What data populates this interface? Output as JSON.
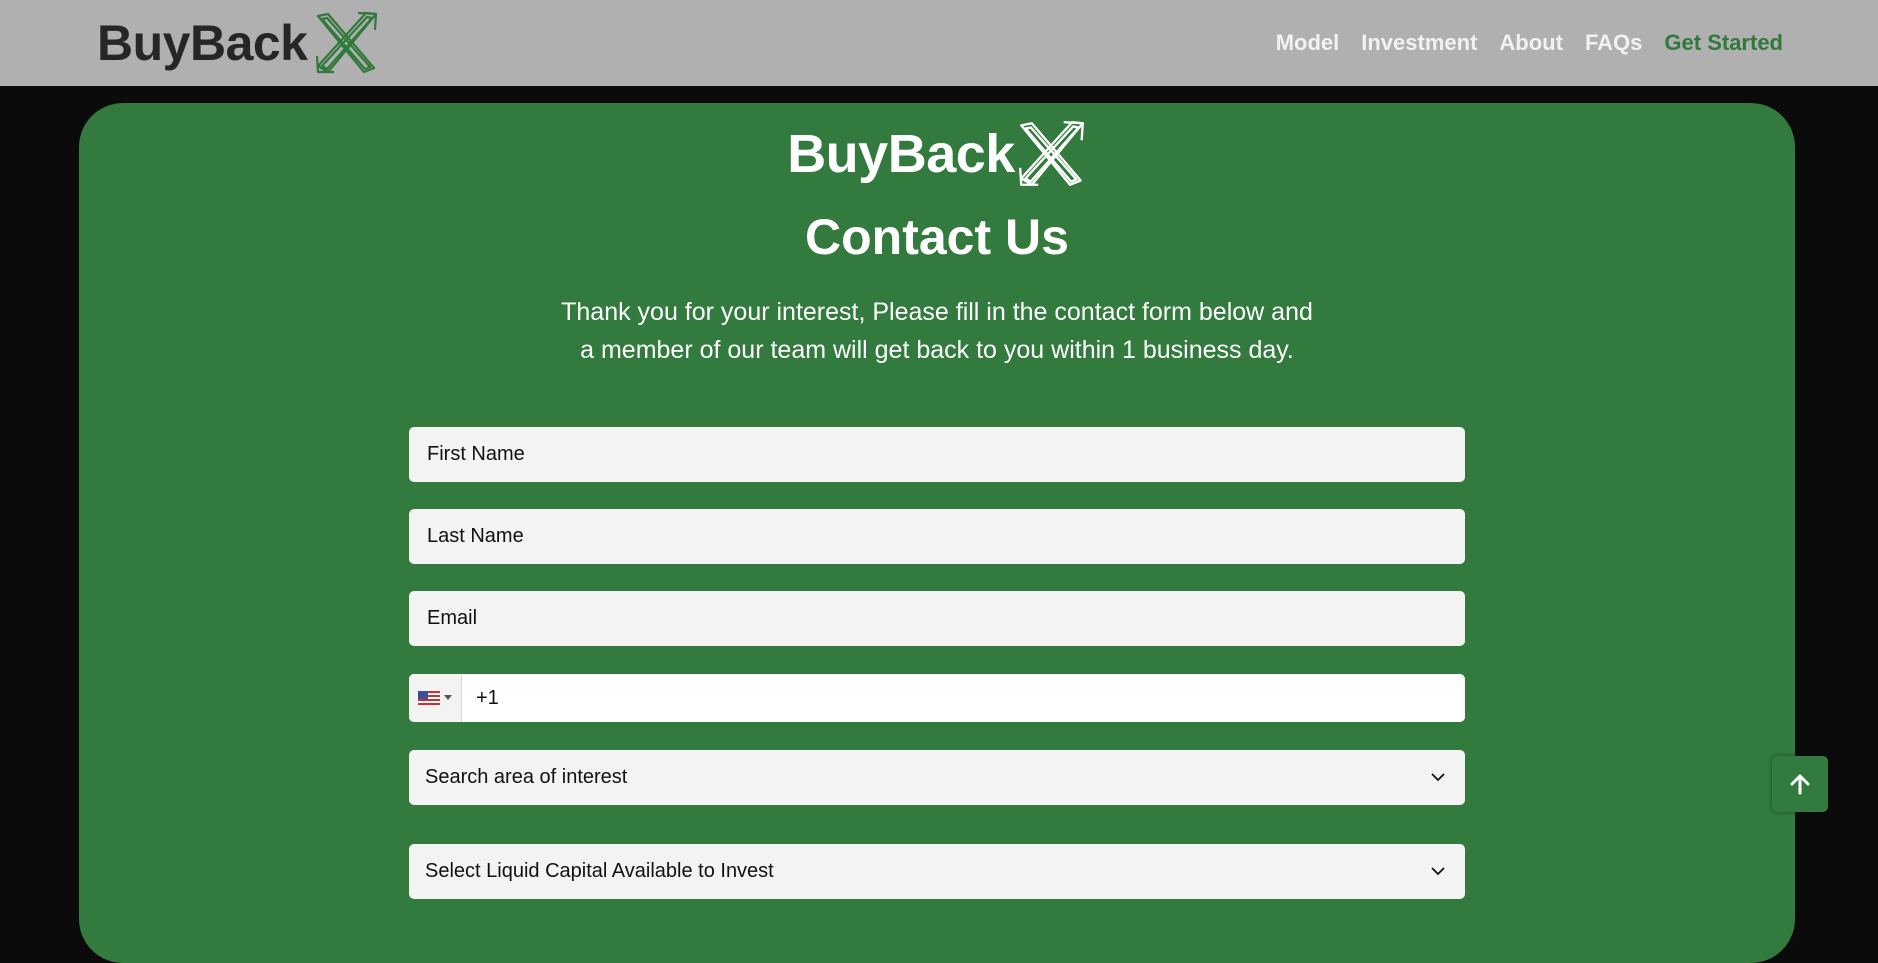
{
  "header": {
    "brand": "BuyBack",
    "nav": [
      {
        "label": "Model"
      },
      {
        "label": "Investment"
      },
      {
        "label": "About"
      },
      {
        "label": "FAQs"
      }
    ],
    "cta_label": "Get Started"
  },
  "card": {
    "brand": "BuyBack",
    "title": "Contact Us",
    "intro_line1": "Thank you for your interest, Please fill in the contact form below and",
    "intro_line2": "a member of our team will get back to you within 1 business day."
  },
  "form": {
    "first_name_placeholder": "First Name",
    "last_name_placeholder": "Last Name",
    "email_placeholder": "Email",
    "phone_country": "us-flag-icon",
    "phone_code": "+1",
    "area_select": "Search area of interest",
    "capital_select": "Select Liquid Capital Available to Invest"
  },
  "colors": {
    "brand_green": "#327a3d",
    "header_bg": "#b0b0b0",
    "page_bg": "#0b0b0b"
  },
  "icons": {
    "scroll_top": "arrow-up-icon",
    "dropdown": "chevron-down-icon",
    "logo_mark": "x-arrows-logo-icon"
  }
}
